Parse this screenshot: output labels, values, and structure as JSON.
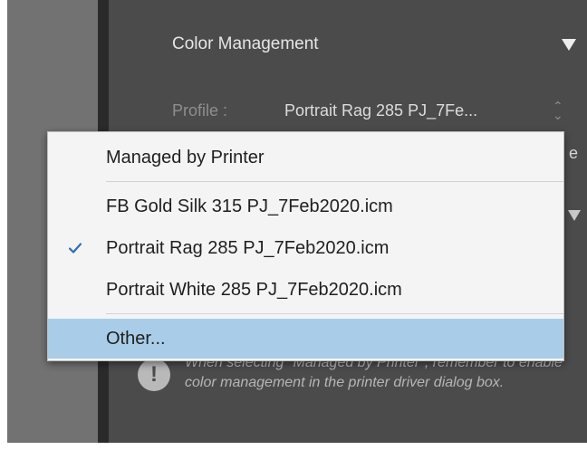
{
  "panel": {
    "section_title": "Color Management",
    "collapse_icon": "triangle-down-icon",
    "profile_label": "Profile :",
    "profile_value": "Portrait Rag 285 PJ_7Fe...",
    "stepper_icon": "up-down-stepper-icon",
    "hidden_edge_text": "e"
  },
  "dropdown": {
    "items": [
      {
        "label": "Managed by Printer",
        "checked": false,
        "highlighted": false
      },
      {
        "label": "FB Gold Silk 315 PJ_7Feb2020.icm",
        "checked": false,
        "highlighted": false
      },
      {
        "label": "Portrait Rag 285 PJ_7Feb2020.icm",
        "checked": true,
        "highlighted": false
      },
      {
        "label": "Portrait White 285 PJ_7Feb2020.icm",
        "checked": false,
        "highlighted": false
      },
      {
        "label": "Other...",
        "checked": false,
        "highlighted": true
      }
    ],
    "check_icon": "checkmark-icon"
  },
  "note": {
    "icon": "exclamation-icon",
    "text": "When selecting \"Managed by Printer\", remember to enable color management in the printer driver dialog box."
  },
  "colors": {
    "panel_bg": "#4b4b4b",
    "left_panel_bg": "#727272",
    "menu_bg": "#f4f4f4",
    "menu_highlight": "#a9cde8",
    "check_color": "#2f6fb5"
  }
}
